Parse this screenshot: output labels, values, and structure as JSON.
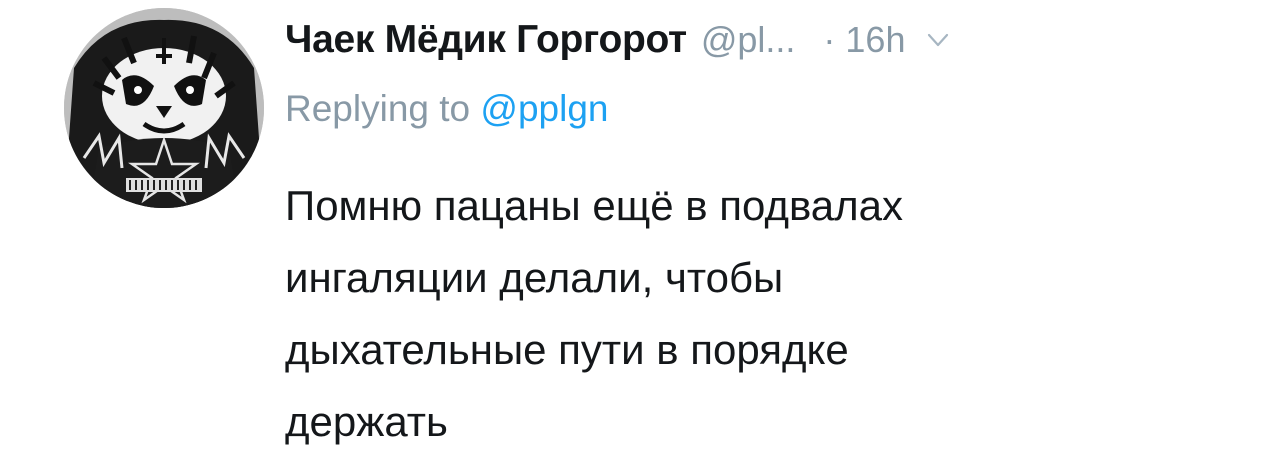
{
  "tweet": {
    "display_name": "Чаек Мёдик Горгорот",
    "handle": "@pl...",
    "time": "· 16h",
    "chevron_icon": "chevron-down-icon",
    "reply_prefix": "Replying to",
    "reply_handle": "@pplgn",
    "text_lines": [
      "Помню пацаны ещё в подвалах",
      "ингаляции делали, чтобы",
      "дыхательные пути в порядке",
      "держать"
    ]
  },
  "colors": {
    "text_primary": "#14171a",
    "text_secondary": "#8899a6",
    "link": "#1da1f2"
  }
}
